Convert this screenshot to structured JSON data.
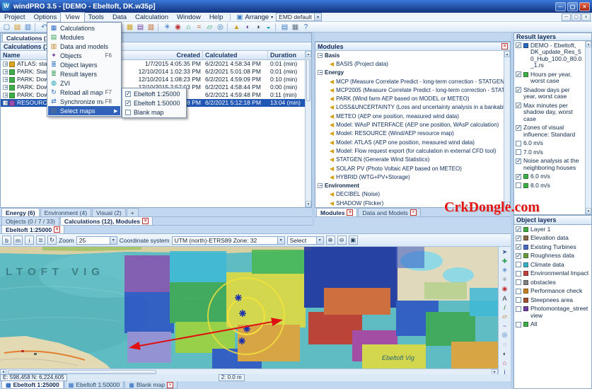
{
  "window": {
    "title": "windPRO 3.5 - [DEMO - Ebeltoft, DK.w35p]"
  },
  "icons": {
    "minimize": "─",
    "maximize": "▢",
    "close": "×",
    "dropdown": "▾",
    "close_small": "×",
    "up": "▲",
    "down": "▼",
    "left": "◄",
    "right": "►",
    "map_tab": "▦",
    "app_letter": "W"
  },
  "menu": {
    "items": [
      {
        "label": "Project"
      },
      {
        "label": "Options"
      },
      {
        "label": "View",
        "active": true
      },
      {
        "label": "Tools"
      },
      {
        "label": "Data"
      },
      {
        "label": "Calculation"
      },
      {
        "label": "Window"
      },
      {
        "label": "Help"
      }
    ],
    "arrange": "Arrange",
    "profile": "EMD default"
  },
  "toolbar": {
    "icons": [
      {
        "name": "new-project-icon",
        "glyph": "▢",
        "color": "#3a7ac0"
      },
      {
        "name": "open-project-icon",
        "glyph": "▤",
        "color": "#d09020"
      },
      {
        "name": "save-project-icon",
        "glyph": "▥",
        "color": "#3a7ac0"
      },
      {
        "sep": true,
        "name": "toolbar-separator"
      },
      {
        "name": "undo-icon",
        "glyph": "↶",
        "color": "#3a7ac0"
      },
      {
        "name": "redo-icon",
        "glyph": "↷",
        "color": "#90a8c0"
      },
      {
        "sep": true,
        "name": "toolbar-separator"
      },
      {
        "name": "globe-icon",
        "glyph": "◍",
        "color": "#2a9a4a"
      },
      {
        "name": "maps-icon",
        "glyph": "▧",
        "color": "#4a8a3a"
      },
      {
        "name": "object-layers-icon",
        "glyph": "≣",
        "color": "#2a6ac0"
      },
      {
        "name": "result-layers-icon",
        "glyph": "≣",
        "color": "#2a9a4a"
      },
      {
        "name": "zvi-icon",
        "glyph": "◈",
        "color": "#0a9ab0"
      },
      {
        "sep": true,
        "name": "toolbar-separator"
      },
      {
        "name": "calculations-icon",
        "glyph": "▦",
        "color": "#d0a020"
      },
      {
        "name": "modules-icon",
        "glyph": "▤",
        "color": "#7040a0"
      },
      {
        "name": "data-models-icon",
        "glyph": "▥",
        "color": "#c06020"
      },
      {
        "sep": true,
        "name": "toolbar-separator"
      },
      {
        "name": "wtg-icon",
        "glyph": "✳",
        "color": "#2a6ac0"
      },
      {
        "name": "meteo-icon",
        "glyph": "◉",
        "color": "#c03030"
      },
      {
        "name": "site-icon",
        "glyph": "⌂",
        "color": "#2a9a4a"
      },
      {
        "name": "line-object-icon",
        "glyph": "≈",
        "color": "#c06020"
      },
      {
        "name": "area-object-icon",
        "glyph": "▱",
        "color": "#2a9a4a"
      },
      {
        "name": "camera-icon",
        "glyph": "◎",
        "color": "#3a7ac0"
      },
      {
        "sep": true,
        "name": "toolbar-separator"
      },
      {
        "name": "energy-icon",
        "glyph": "▲",
        "color": "#d0a020"
      },
      {
        "name": "decibel-icon",
        "glyph": "◖",
        "color": "#7040a0"
      },
      {
        "name": "shadow-icon",
        "glyph": "◑",
        "color": "#404040"
      },
      {
        "name": "visual-icon",
        "glyph": "◒",
        "color": "#0a9ab0"
      },
      {
        "sep": true,
        "name": "toolbar-separator"
      },
      {
        "name": "report-icon",
        "glyph": "▤",
        "color": "#3a7ac0"
      },
      {
        "name": "print-icon",
        "glyph": "▦",
        "color": "#607080"
      },
      {
        "name": "help-icon",
        "glyph": "?",
        "color": "#2a6ac0"
      }
    ]
  },
  "view_menu": {
    "items": [
      {
        "label": "Calculations",
        "glyph": "▦",
        "color": "#2a6ac0"
      },
      {
        "label": "Modules",
        "glyph": "▤",
        "color": "#2a9a4a"
      },
      {
        "label": "Data and models",
        "glyph": "▥",
        "color": "#c08020"
      },
      {
        "label": "Objects",
        "shortcut": "F6",
        "glyph": "✦",
        "color": "#7040a0"
      },
      {
        "label": "Object layers",
        "glyph": "≣",
        "color": "#2a6ac0"
      },
      {
        "label": "Result layers",
        "glyph": "≣",
        "color": "#2a9a4a"
      },
      {
        "label": "ZVI",
        "glyph": "◍",
        "color": "#0a9ab0"
      },
      {
        "label": "Reload all maps",
        "shortcut": "F7",
        "glyph": "↻",
        "color": "#2a6ac0"
      },
      {
        "label": "Synchronize maps",
        "shortcut": "F8",
        "glyph": "⇄",
        "color": "#2a6ac0"
      },
      {
        "label": "Select maps",
        "highlight": true,
        "arrow": "▶",
        "glyph": "▧",
        "color": "#607080"
      }
    ],
    "submenu": [
      {
        "label": "Ebeltoft 1:25000",
        "checked": true
      },
      {
        "label": "Ebeltoft 1:50000",
        "checked": true
      },
      {
        "label": "Blank map",
        "checked": false
      }
    ]
  },
  "calc_panel": {
    "tab": "Calculations (12), Mo...",
    "caption": "Calculations (12)",
    "columns": [
      "Name",
      "Created",
      "Calculated",
      "Duration"
    ],
    "rows": [
      {
        "name": "ATLAS: sta...",
        "created": "1/7/2015 4:05:35 PM",
        "calculated": "6/2/2021 4:58:34 PM",
        "duration": "0:01 (min)",
        "icon": "#d9a520"
      },
      {
        "name": "PARK: Stan...",
        "created": "12/10/2014 1:02:33 PM",
        "calculated": "6/2/2021 5:01:08 PM",
        "duration": "0:01 (min)",
        "icon": "#3fae4a"
      },
      {
        "name": "PARK: Dow...",
        "created": "12/10/2014 1:08:23 PM",
        "calculated": "6/2/2021 4:59:09 PM",
        "duration": "0:10 (min)",
        "icon": "#3fae4a"
      },
      {
        "name": "PARK: Dow...",
        "created": "12/10/2015 2:57:03 PM",
        "calculated": "6/2/2021 4:58:44 PM",
        "duration": "0:00 (min)",
        "icon": "#3fae4a"
      },
      {
        "name": "PARK: Dow...",
        "created": "",
        "calculated": "6/2/2021 4:59:48 PM",
        "duration": "0:11 (min)",
        "icon": "#3fae4a"
      },
      {
        "name": "RESOURCE: Wind resource map",
        "created": "4/8/2015 2:13:48 PM",
        "calculated": "6/2/2021 5:12:18 PM",
        "duration": "13:04 (min)",
        "icon": "#9a4fb0",
        "selected": true
      }
    ],
    "tabs": [
      {
        "label": "Energy (6)",
        "active": true
      },
      {
        "label": "Environment (4)"
      },
      {
        "label": "Visual (2)"
      },
      {
        "label": "+"
      }
    ],
    "bottom_tabs": [
      {
        "label": "Objects (0 / 7 / 33)"
      },
      {
        "label": "Calculations (12), Modules",
        "active": true,
        "closable": true
      }
    ]
  },
  "modules_panel": {
    "title": "Modules",
    "lines": [
      {
        "g": true,
        "label": "Basis"
      },
      {
        "label": "BASIS (Project data)"
      },
      {
        "g": true,
        "label": "Energy"
      },
      {
        "label": "MCP (Measure Correlate Predict - long-term correction - STATGEN)"
      },
      {
        "label": "MCP2005 (Measure Correlate Predict - long-term correction - STATGEN)"
      },
      {
        "label": "PARK (Wind farm AEP based on MODEL or METEO)"
      },
      {
        "label": "LOSS&UNCERTAINTY (Loss and uncertainty analysis in a bankable forma"
      },
      {
        "label": "METEO (AEP one position, measured wind data)"
      },
      {
        "label": "Model: WAsP INTERFACE (AEP one position, WAsP calculation)"
      },
      {
        "label": "Model: RESOURCE (Wind/AEP resource map)"
      },
      {
        "label": "Model: ATLAS (AEP one position, measured wind data)"
      },
      {
        "label": "Model: Flow request export (for calculation in external CFD tool)"
      },
      {
        "label": "STATGEN (Generate Wind Statistics)"
      },
      {
        "label": "SOLAR PV (Photo Voltaic AEP based on METEO)"
      },
      {
        "label": "HYBRID (WTG+PV+Storage)"
      },
      {
        "g": true,
        "label": "Environment"
      },
      {
        "label": "DECIBEL (Noise)"
      },
      {
        "label": "SHADOW (Flicker)"
      }
    ],
    "tabs": [
      {
        "label": "Modules",
        "active": true,
        "closable": true
      },
      {
        "label": "Data and Models",
        "closable": true
      }
    ]
  },
  "result_panel": {
    "title": "Result layers",
    "items": [
      {
        "checked": true,
        "label": "DEMO - Ebeltoft, DK_update_Res_50_Hub_100.0_80.0_1.rs",
        "swatch": "#2a6ac0"
      },
      {
        "checked": true,
        "label": "Hours per year, worst case",
        "swatch": "#3fae4a"
      },
      {
        "checked": true,
        "label": "Shadow days per year, worst case"
      },
      {
        "checked": true,
        "label": "Max minutes per shadow day, worst case"
      },
      {
        "checked": true,
        "label": "Zones of visual influence: Standard"
      },
      {
        "checked": false,
        "label": "6.0 m/s"
      },
      {
        "checked": false,
        "label": "7.0 m/s"
      },
      {
        "checked": true,
        "label": "Noise analysis at the neighboring houses"
      },
      {
        "checked": true,
        "label": "6.0 m/s",
        "swatch": "#3fae4a"
      },
      {
        "checked": false,
        "label": "8.0 m/s",
        "swatch": "#3fae4a"
      }
    ]
  },
  "object_panel": {
    "title": "Object layers",
    "items": [
      {
        "checked": true,
        "label": "Layer 1",
        "swatch": "#44aa44"
      },
      {
        "checked": true,
        "label": "Elevation data",
        "swatch": "#8a6a4a"
      },
      {
        "checked": true,
        "label": "Existing Turbines",
        "swatch": "#4a6ac0"
      },
      {
        "checked": true,
        "label": "Roughness data",
        "swatch": "#6a9a3a"
      },
      {
        "checked": false,
        "label": "Climate data",
        "swatch": "#3ab0c0"
      },
      {
        "checked": false,
        "label": "Environmental Impact",
        "swatch": "#c04040"
      },
      {
        "checked": false,
        "label": "obstacles",
        "swatch": "#808080"
      },
      {
        "checked": false,
        "label": "Performance check",
        "swatch": "#c08020"
      },
      {
        "checked": false,
        "label": "Steepnees area",
        "swatch": "#a0522d"
      },
      {
        "checked": false,
        "label": "Photomontage_street view",
        "swatch": "#7040a0"
      },
      {
        "checked": false,
        "label": "All",
        "swatch": "#3fae4a"
      }
    ]
  },
  "map": {
    "tab": "Ebeltoft 1:25000",
    "toolbar": {
      "small_buttons": [
        {
          "name": "map-btn-bold",
          "glyph": "b"
        },
        {
          "name": "map-btn-measure",
          "glyph": "m"
        },
        {
          "name": "map-btn-info",
          "glyph": "i"
        },
        {
          "name": "map-layers-button",
          "glyph": "≣"
        },
        {
          "name": "map-refresh-button",
          "glyph": "↻"
        }
      ],
      "zoom_label": "Zoom",
      "zoom_value": "25",
      "coord_label": "Coordinate system",
      "coord_value": "UTM (north)-ETRS89 Zone: 32",
      "select_label": "Select",
      "right_buttons": [
        {
          "name": "zoom-in-button",
          "glyph": "⊕"
        },
        {
          "name": "zoom-out-button",
          "glyph": "⊖"
        },
        {
          "name": "zoom-extent-button",
          "glyph": "▣"
        }
      ]
    },
    "tools": [
      {
        "name": "map-tool-pointer",
        "glyph": "➤",
        "color": "#3a5a8c"
      },
      {
        "name": "map-tool-pan",
        "glyph": "✚",
        "color": "#2a9a4a"
      },
      {
        "name": "map-tool-new-wtg",
        "glyph": "✳",
        "color": "#2060c0"
      },
      {
        "name": "map-tool-existing-wtg",
        "glyph": "✳",
        "color": "#909090"
      },
      {
        "name": "map-tool-meteo",
        "glyph": "◉",
        "color": "#c03030"
      },
      {
        "name": "map-tool-text",
        "glyph": "A",
        "color": "#303030"
      },
      {
        "name": "map-tool-line",
        "glyph": "/",
        "color": "#207020"
      },
      {
        "name": "map-tool-area",
        "glyph": "▱",
        "color": "#c07020"
      },
      {
        "name": "map-tool-ruler",
        "glyph": "~",
        "color": "#7030a0"
      },
      {
        "name": "map-tool-camera",
        "glyph": "◎",
        "color": "#3070c0"
      },
      {
        "name": "map-tool-noise",
        "glyph": "◌",
        "color": "#a02080"
      },
      {
        "name": "map-tool-shadow",
        "glyph": "◐",
        "color": "#404040"
      },
      {
        "name": "map-tool-house",
        "glyph": "⌂",
        "color": "#c04040"
      },
      {
        "name": "map-tool-info",
        "glyph": "i",
        "color": "#2050a0"
      }
    ],
    "labels": {
      "bay": "LTOFT VIG",
      "place": "Ebeltoft Vig"
    },
    "status": {
      "coords": "E: 598,458 N: 6,224,605",
      "measure": "2: 0.0 m"
    },
    "bottom_tabs": [
      {
        "label": "Ebeltoft 1:25000",
        "active": true
      },
      {
        "label": "Ebeltoft 1:50000"
      },
      {
        "label": "Blank map",
        "closable": true
      }
    ]
  },
  "watermark": "CrkDongle.com"
}
